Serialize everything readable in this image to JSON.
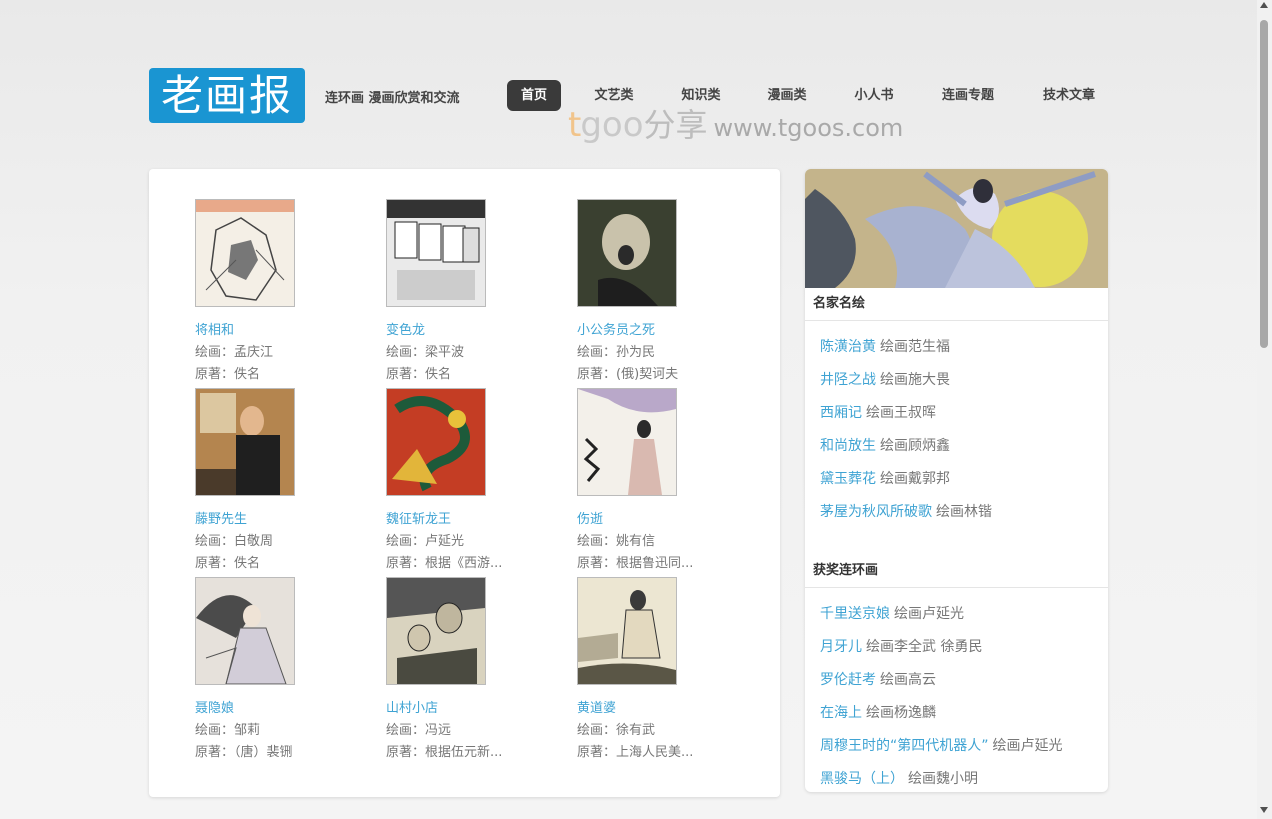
{
  "header": {
    "logo_text": "老画报",
    "tagline": "连环画 漫画欣赏和交流",
    "nav": [
      {
        "label": "首页",
        "active": true
      },
      {
        "label": "文艺类",
        "active": false
      },
      {
        "label": "知识类",
        "active": false
      },
      {
        "label": "漫画类",
        "active": false
      },
      {
        "label": "小人书",
        "active": false
      },
      {
        "label": "连画专题",
        "active": false
      },
      {
        "label": "技术文章",
        "active": false
      }
    ],
    "watermark": {
      "brand_t": "t",
      "brand_oo": "goo",
      "brand_cn": "分享",
      "url": "www.tgoos.com"
    }
  },
  "books": [
    {
      "title": "将相和",
      "artist": "绘画：孟庆江",
      "original": "原著：佚名"
    },
    {
      "title": "变色龙",
      "artist": "绘画：梁平波",
      "original": "原著：佚名"
    },
    {
      "title": "小公务员之死",
      "artist": "绘画：孙为民",
      "original": "原著：(俄)契诃夫"
    },
    {
      "title": "藤野先生",
      "artist": "绘画：白敬周",
      "original": "原著：佚名"
    },
    {
      "title": "魏征斩龙王",
      "artist": "绘画：卢延光",
      "original": "原著：根据《西游..."
    },
    {
      "title": "伤逝",
      "artist": "绘画：姚有信",
      "original": "原著：根据鲁迅同..."
    },
    {
      "title": "聂隐娘",
      "artist": "绘画：邹莉",
      "original": "原著：（唐）裴铏"
    },
    {
      "title": "山村小店",
      "artist": "绘画：冯远",
      "original": "原著：根据伍元新..."
    },
    {
      "title": "黄道婆",
      "artist": "绘画：徐有武",
      "original": "原著：上海人民美..."
    }
  ],
  "sidebar": {
    "sections": [
      {
        "heading": "名家名绘",
        "items": [
          {
            "title": "陈潢治黄",
            "meta": "绘画范生福"
          },
          {
            "title": "井陉之战",
            "meta": "绘画施大畏"
          },
          {
            "title": "西厢记",
            "meta": "绘画王叔晖"
          },
          {
            "title": "和尚放生",
            "meta": "绘画顾炳鑫"
          },
          {
            "title": "黛玉葬花",
            "meta": "绘画戴郭邦"
          },
          {
            "title": "茅屋为秋风所破歌",
            "meta": "绘画林锴"
          }
        ]
      },
      {
        "heading": "获奖连环画",
        "items": [
          {
            "title": "千里送京娘",
            "meta": "绘画卢延光"
          },
          {
            "title": "月牙儿",
            "meta": "绘画李全武 徐勇民"
          },
          {
            "title": "罗伦赶考",
            "meta": "绘画高云"
          },
          {
            "title": "在海上",
            "meta": "绘画杨逸麟"
          },
          {
            "title": "周穆王时的“第四代机器人”",
            "meta": "绘画卢延光"
          },
          {
            "title": "黑骏马（上）",
            "meta": "绘画魏小明"
          }
        ]
      }
    ]
  },
  "colors": {
    "accent": "#1a95d2",
    "link": "#3fa3d3",
    "nav_active_bg": "#3a3a3a"
  }
}
